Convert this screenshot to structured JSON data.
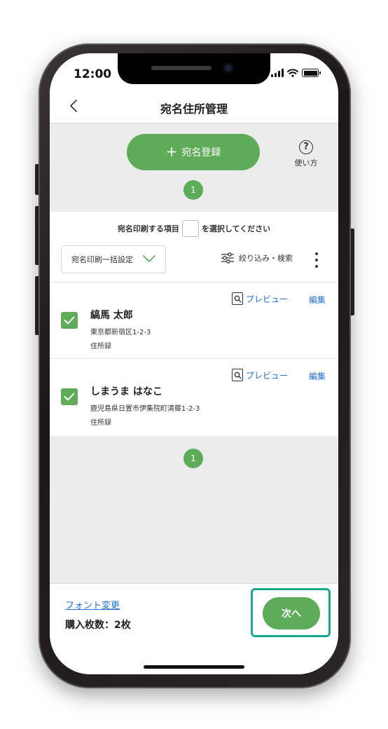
{
  "status_bar": {
    "time": "12:00"
  },
  "nav": {
    "title": "宛名住所管理"
  },
  "toolbar": {
    "register_plus": "+",
    "register_label": "宛名登録",
    "help_symbol": "?",
    "help_label": "使い方"
  },
  "pagination": {
    "current_page": "1"
  },
  "settings": {
    "select_hint_before": "宛名印刷する項目",
    "select_hint_after": "を選択してください",
    "batch_select_label": "宛名印刷一括設定",
    "filter_label": "絞り込み・検索"
  },
  "addresses": [
    {
      "name": "縞馬 太郎",
      "address": "東京都新宿区1-2-3",
      "type": "住所録",
      "checked": true,
      "preview_label": "プレビュー",
      "edit_label": "編集"
    },
    {
      "name": "しまうま はなこ",
      "address": "鹿児島県日置市伊集院町清藤1-2-3",
      "type": "住所録",
      "checked": true,
      "preview_label": "プレビュー",
      "edit_label": "編集"
    }
  ],
  "footer": {
    "font_change_label": "フォント変更",
    "purchase_count": "購入枚数：2枚",
    "next_label": "次へ"
  },
  "colors": {
    "accent_green": "#5eab5a",
    "link_blue": "#1f6fd1",
    "highlight_teal": "#17a890"
  }
}
